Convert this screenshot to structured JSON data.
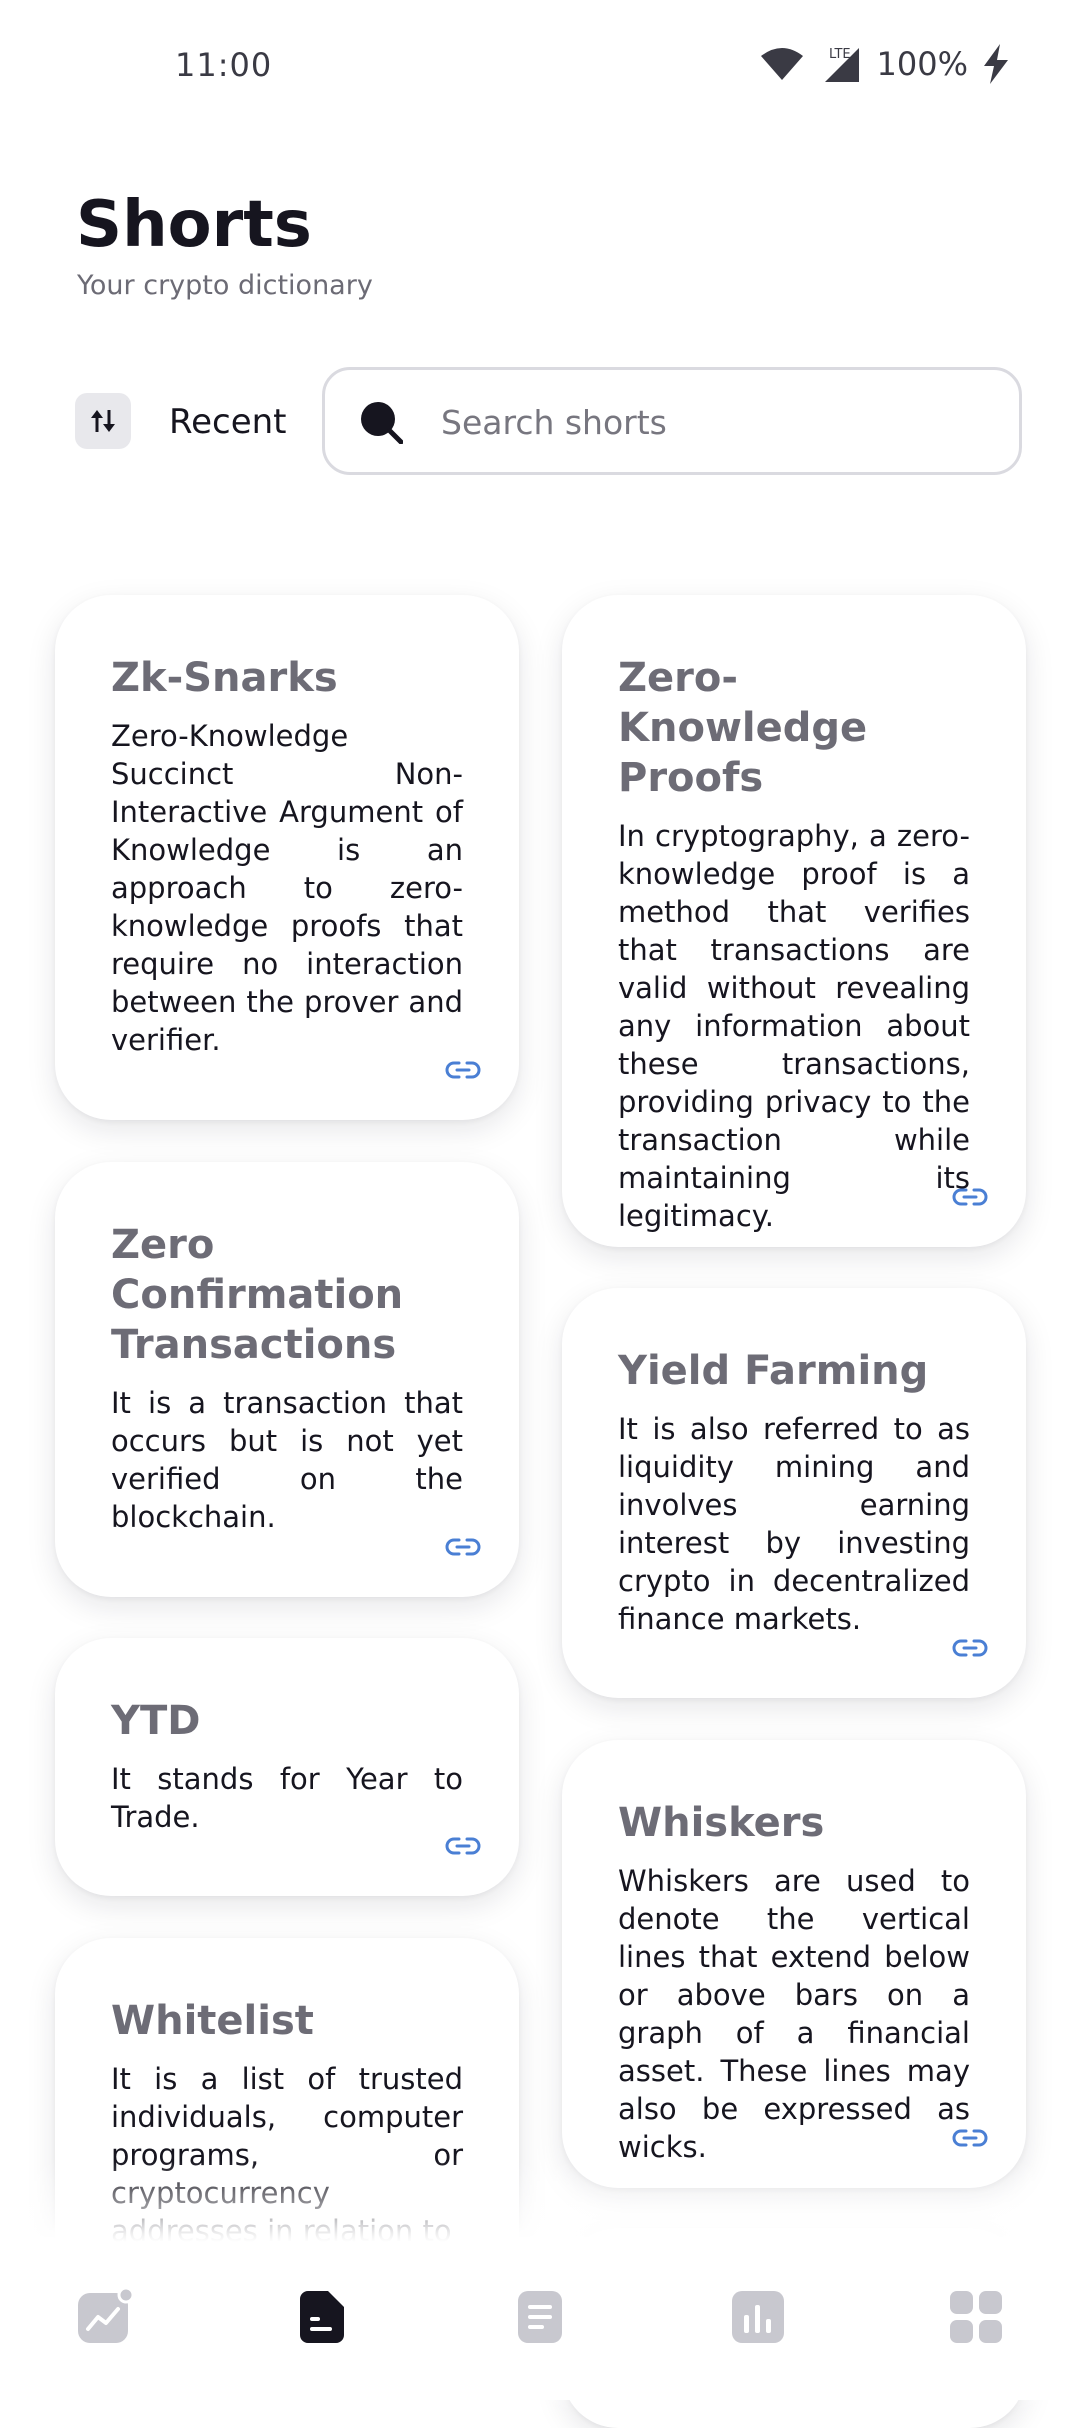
{
  "status": {
    "time": "11:00",
    "battery": "100%",
    "network": "LTE"
  },
  "header": {
    "title": "Shorts",
    "subtitle": "Your crypto dictionary"
  },
  "filter": {
    "sort_label": "Recent"
  },
  "search": {
    "placeholder": "Search shorts"
  },
  "cards": [
    {
      "title": "Zk-Snarks",
      "body": "Zero-Knowledge Succinct Non-Interactive Argument of Knowledge is an approach to zero-knowledge proofs that require no interaction between the prover and verifier."
    },
    {
      "title": "Zero-Knowledge Proofs",
      "body": "In cryptography, a zero-knowledge proof is a method that verifies that transactions are valid without revealing any information about these transactions, providing privacy to the transaction while maintaining its legitimacy."
    },
    {
      "title": "Zero Confirmation Transactions",
      "body": "It is a transaction that occurs but is not yet verified on the blockchain."
    },
    {
      "title": "Yield Farming",
      "body": "It is also referred to as liquidity mining and involves earning interest by investing crypto in decentralized finance markets."
    },
    {
      "title": "YTD",
      "body": "It stands for Year to Trade."
    },
    {
      "title": "Whiskers",
      "body": "Whiskers are used to denote the vertical lines that extend below or above bars on a graph of a financial asset. These lines may also be expressed as wicks."
    },
    {
      "title": "Whitelist",
      "body": "It is a list of trusted individuals, computer programs, or cryptocurrency addresses in relation to"
    }
  ],
  "nav": {
    "items": [
      "chart-line-icon",
      "document-icon",
      "list-icon",
      "bar-chart-icon",
      "grid-icon"
    ],
    "active_index": 1
  },
  "colors": {
    "accent": "#16151f",
    "link": "#4a7fd4",
    "muted": "#6d6c76",
    "inactive_nav": "#c8c8cf"
  }
}
